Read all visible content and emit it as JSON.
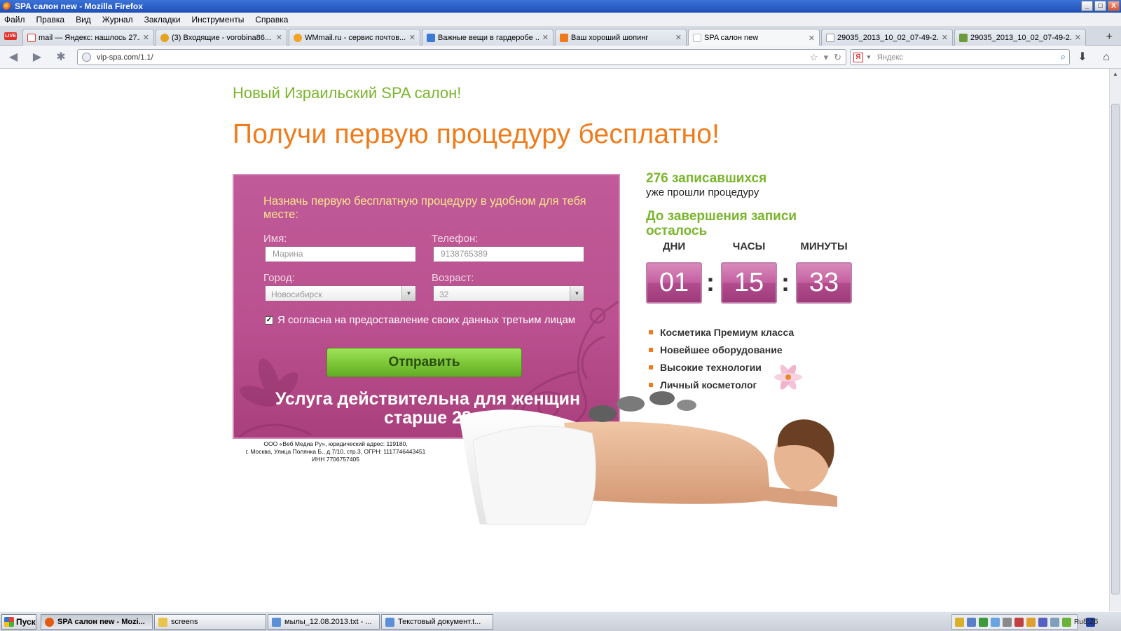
{
  "window": {
    "title": "SPA салон new - Mozilla Firefox",
    "buttons": [
      "_",
      "□",
      "X"
    ]
  },
  "menu": [
    "Файл",
    "Правка",
    "Вид",
    "Журнал",
    "Закладки",
    "Инструменты",
    "Справка"
  ],
  "tabs": [
    {
      "label": "mail — Яндекс: нашлось 27...",
      "color": "#e23a2a"
    },
    {
      "label": "(3) Входящие - vorobina86...",
      "color": "#e6a21e"
    },
    {
      "label": "WMmail.ru - сервис почтов...",
      "color": "#f0a325"
    },
    {
      "label": "Важные вещи в гардеробе ...",
      "color": "#3a7bd5"
    },
    {
      "label": "Ваш хороший шопинг",
      "color": "#f07a1a"
    },
    {
      "label": "SPA салон new",
      "color": "#ffffff"
    },
    {
      "label": "29035_2013_10_02_07-49-2...",
      "color": "#ffffff"
    },
    {
      "label": "29035_2013_10_02_07-49-2...",
      "color": "#6c9a3c"
    }
  ],
  "live_badge": "LIVE",
  "nav": {
    "url": "vip-spa.com/1.1/",
    "search_placeholder": "Яндекс",
    "search_logo": "Я"
  },
  "page": {
    "subheading": "Новый Израильский SPA салон!",
    "heading": "Получи первую процедуру бесплатно!",
    "form": {
      "intro": "Назначь первую бесплатную процедуру в удобном для тебя месте:",
      "name_label": "Имя:",
      "name_placeholder": "Марина",
      "phone_label": "Телефон:",
      "phone_placeholder": "9138765389",
      "city_label": "Город:",
      "city_value": "Новосибирск",
      "age_label": "Возраст:",
      "age_value": "32",
      "consent": "Я согласна на предоставление своих данных третьим лицам",
      "consent_checked": true,
      "submit": "Отправить",
      "note": "Услуга действительна для женщин старше 28"
    },
    "legal": [
      "ООО «Веб Медиа Ру», юридический адрес: 119180,",
      "г. Москва, Улица Полянка Б., д.7/10, стр.3, ОГРН: 1117746443451",
      "ИНН 7706757405"
    ],
    "signed_count": "276 записавшихся",
    "signed_text": "уже прошли процедуру",
    "deadline": "До завершения записи осталось",
    "countdown": {
      "days_label": "ДНИ",
      "days": "01",
      "hours_label": "ЧАСЫ",
      "hours": "15",
      "minutes_label": "МИНУТЫ",
      "minutes": "33",
      "separator": ":"
    },
    "features": [
      "Косметика Премиум класса",
      "Новейшее оборудование",
      "Высокие технологии",
      "Личный косметолог"
    ],
    "colors": {
      "green": "#7ab52c",
      "orange": "#ef7b1a",
      "pink": "#bb5190",
      "button": "#7ec83a"
    }
  },
  "taskbar": {
    "start": "Пуск",
    "tasks": [
      {
        "label": "SPA салон new - Mozi...",
        "color": "#e25b12"
      },
      {
        "label": "screens",
        "color": "#e9c34a"
      },
      {
        "label": "мылы_12.08.2013.txt - ...",
        "color": "#5b8fd6"
      },
      {
        "label": "Текстовый документ.t...",
        "color": "#5b8fd6"
      }
    ],
    "tray_lang": "Ru",
    "clock": "8:26"
  }
}
